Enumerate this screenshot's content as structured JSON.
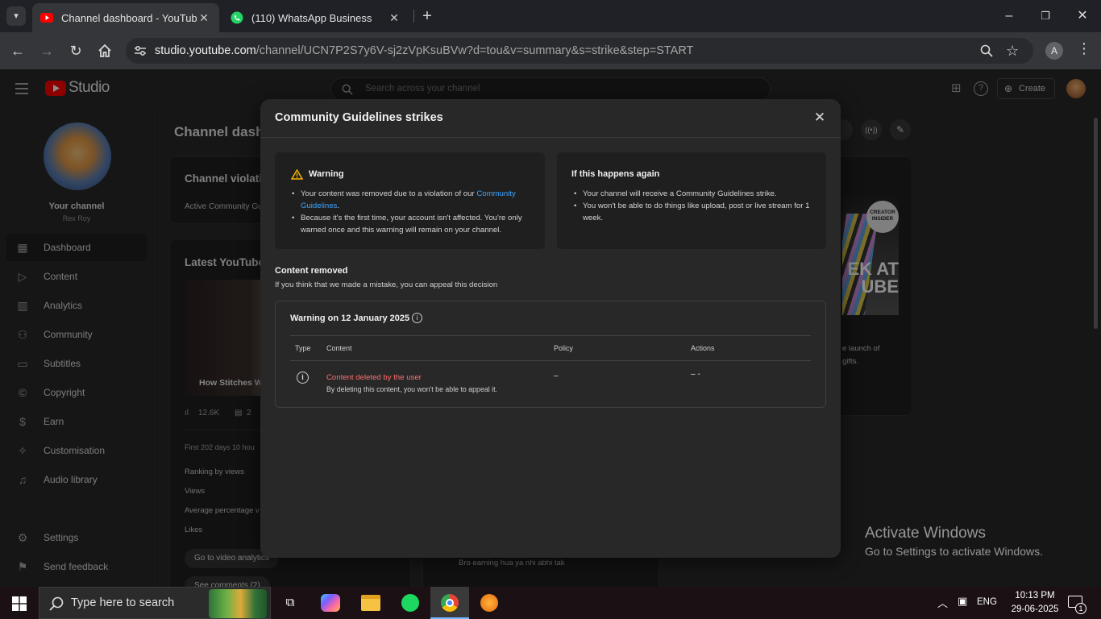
{
  "browser": {
    "tabs": [
      {
        "title": "Channel dashboard - YouTube Studio",
        "active": true
      },
      {
        "title": "(110) WhatsApp Business",
        "active": false
      }
    ],
    "url_host": "studio.youtube.com",
    "url_path": "/channel/UCN7P2S7y6V-sj2zVpKsuBVw?d=tou&v=summary&s=strike&step=START",
    "profile_initial": "A"
  },
  "studio": {
    "logo_text": "Studio",
    "search_placeholder": "Search across your channel",
    "create_label": "Create",
    "channel_label": "Your channel",
    "channel_name": "Rex Roy",
    "nav": [
      {
        "label": "Dashboard",
        "icon": "dashboard-icon"
      },
      {
        "label": "Content",
        "icon": "content-icon"
      },
      {
        "label": "Analytics",
        "icon": "analytics-icon"
      },
      {
        "label": "Community",
        "icon": "community-icon"
      },
      {
        "label": "Subtitles",
        "icon": "subtitles-icon"
      },
      {
        "label": "Copyright",
        "icon": "copyright-icon"
      },
      {
        "label": "Earn",
        "icon": "earn-icon"
      },
      {
        "label": "Customisation",
        "icon": "customisation-icon"
      },
      {
        "label": "Audio library",
        "icon": "audio-library-icon"
      }
    ],
    "nav_bottom": [
      {
        "label": "Settings",
        "icon": "settings-icon"
      },
      {
        "label": "Send feedback",
        "icon": "feedback-icon"
      }
    ],
    "page_title": "Channel dash",
    "violations_title": "Channel violati",
    "violations_sub": "Active Community Gu",
    "latest_title": "Latest YouTube",
    "video_title": "How Stitches W",
    "video_views": "12.6K",
    "video_comments": "2",
    "first_days": "First 202 days 10 hou",
    "stats": [
      "Ranking by views",
      "Views",
      "Average percentage v",
      "Likes"
    ],
    "go_analytics": "Go to video analytics",
    "see_comments": "See comments (2)",
    "comment_text": "Bro earning  hua ya nhi abhi tak",
    "insider_badge": "CREATOR INSIDER",
    "insider_big": "EK AT UBE",
    "insider_text1": "e launch of",
    "insider_text2": "gifts."
  },
  "modal": {
    "title": "Community Guidelines strikes",
    "warning": {
      "title": "Warning",
      "b1_pre": "Your content was removed due to a violation of our ",
      "b1_link": "Community Guidelines",
      "b1_post": ".",
      "b2": "Because it's the first time, your account isn't affected. You're only warned once and this warning will remain on your channel."
    },
    "again": {
      "title": "If this happens again",
      "b1": "Your channel will receive a Community Guidelines strike.",
      "b2": "You won't be able to do things like upload, post or live stream for 1 week."
    },
    "removed_title": "Content removed",
    "removed_sub": "If you think that we made a mistake, you can appeal this decision",
    "table": {
      "heading": "Warning on 12 January 2025",
      "col_type": "Type",
      "col_content": "Content",
      "col_policy": "Policy",
      "col_actions": "Actions",
      "row_content_title": "Content deleted by the user",
      "row_content_sub": "By deleting this content, you won't be able to appeal it.",
      "row_policy": "–",
      "row_actions": "– -"
    }
  },
  "watermark": {
    "line1": "Activate Windows",
    "line2": "Go to Settings to activate Windows."
  },
  "taskbar": {
    "search_placeholder": "Type here to search",
    "lang": "ENG",
    "time": "10:13 PM",
    "date": "29-06-2025",
    "notif_count": "1"
  },
  "colors": {
    "accent_link": "#3ea6ff",
    "deleted_red": "#ff6e6e",
    "warning_amber": "#f5b400",
    "yt_red": "#ff0000"
  }
}
